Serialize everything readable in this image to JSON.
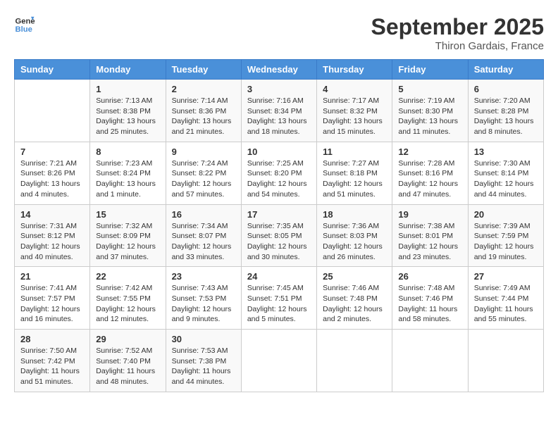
{
  "logo": {
    "line1": "General",
    "line2": "Blue"
  },
  "title": "September 2025",
  "subtitle": "Thiron Gardais, France",
  "days_header": [
    "Sunday",
    "Monday",
    "Tuesday",
    "Wednesday",
    "Thursday",
    "Friday",
    "Saturday"
  ],
  "weeks": [
    [
      {
        "num": "",
        "sunrise": "",
        "sunset": "",
        "daylight": ""
      },
      {
        "num": "1",
        "sunrise": "Sunrise: 7:13 AM",
        "sunset": "Sunset: 8:38 PM",
        "daylight": "Daylight: 13 hours and 25 minutes."
      },
      {
        "num": "2",
        "sunrise": "Sunrise: 7:14 AM",
        "sunset": "Sunset: 8:36 PM",
        "daylight": "Daylight: 13 hours and 21 minutes."
      },
      {
        "num": "3",
        "sunrise": "Sunrise: 7:16 AM",
        "sunset": "Sunset: 8:34 PM",
        "daylight": "Daylight: 13 hours and 18 minutes."
      },
      {
        "num": "4",
        "sunrise": "Sunrise: 7:17 AM",
        "sunset": "Sunset: 8:32 PM",
        "daylight": "Daylight: 13 hours and 15 minutes."
      },
      {
        "num": "5",
        "sunrise": "Sunrise: 7:19 AM",
        "sunset": "Sunset: 8:30 PM",
        "daylight": "Daylight: 13 hours and 11 minutes."
      },
      {
        "num": "6",
        "sunrise": "Sunrise: 7:20 AM",
        "sunset": "Sunset: 8:28 PM",
        "daylight": "Daylight: 13 hours and 8 minutes."
      }
    ],
    [
      {
        "num": "7",
        "sunrise": "Sunrise: 7:21 AM",
        "sunset": "Sunset: 8:26 PM",
        "daylight": "Daylight: 13 hours and 4 minutes."
      },
      {
        "num": "8",
        "sunrise": "Sunrise: 7:23 AM",
        "sunset": "Sunset: 8:24 PM",
        "daylight": "Daylight: 13 hours and 1 minute."
      },
      {
        "num": "9",
        "sunrise": "Sunrise: 7:24 AM",
        "sunset": "Sunset: 8:22 PM",
        "daylight": "Daylight: 12 hours and 57 minutes."
      },
      {
        "num": "10",
        "sunrise": "Sunrise: 7:25 AM",
        "sunset": "Sunset: 8:20 PM",
        "daylight": "Daylight: 12 hours and 54 minutes."
      },
      {
        "num": "11",
        "sunrise": "Sunrise: 7:27 AM",
        "sunset": "Sunset: 8:18 PM",
        "daylight": "Daylight: 12 hours and 51 minutes."
      },
      {
        "num": "12",
        "sunrise": "Sunrise: 7:28 AM",
        "sunset": "Sunset: 8:16 PM",
        "daylight": "Daylight: 12 hours and 47 minutes."
      },
      {
        "num": "13",
        "sunrise": "Sunrise: 7:30 AM",
        "sunset": "Sunset: 8:14 PM",
        "daylight": "Daylight: 12 hours and 44 minutes."
      }
    ],
    [
      {
        "num": "14",
        "sunrise": "Sunrise: 7:31 AM",
        "sunset": "Sunset: 8:12 PM",
        "daylight": "Daylight: 12 hours and 40 minutes."
      },
      {
        "num": "15",
        "sunrise": "Sunrise: 7:32 AM",
        "sunset": "Sunset: 8:09 PM",
        "daylight": "Daylight: 12 hours and 37 minutes."
      },
      {
        "num": "16",
        "sunrise": "Sunrise: 7:34 AM",
        "sunset": "Sunset: 8:07 PM",
        "daylight": "Daylight: 12 hours and 33 minutes."
      },
      {
        "num": "17",
        "sunrise": "Sunrise: 7:35 AM",
        "sunset": "Sunset: 8:05 PM",
        "daylight": "Daylight: 12 hours and 30 minutes."
      },
      {
        "num": "18",
        "sunrise": "Sunrise: 7:36 AM",
        "sunset": "Sunset: 8:03 PM",
        "daylight": "Daylight: 12 hours and 26 minutes."
      },
      {
        "num": "19",
        "sunrise": "Sunrise: 7:38 AM",
        "sunset": "Sunset: 8:01 PM",
        "daylight": "Daylight: 12 hours and 23 minutes."
      },
      {
        "num": "20",
        "sunrise": "Sunrise: 7:39 AM",
        "sunset": "Sunset: 7:59 PM",
        "daylight": "Daylight: 12 hours and 19 minutes."
      }
    ],
    [
      {
        "num": "21",
        "sunrise": "Sunrise: 7:41 AM",
        "sunset": "Sunset: 7:57 PM",
        "daylight": "Daylight: 12 hours and 16 minutes."
      },
      {
        "num": "22",
        "sunrise": "Sunrise: 7:42 AM",
        "sunset": "Sunset: 7:55 PM",
        "daylight": "Daylight: 12 hours and 12 minutes."
      },
      {
        "num": "23",
        "sunrise": "Sunrise: 7:43 AM",
        "sunset": "Sunset: 7:53 PM",
        "daylight": "Daylight: 12 hours and 9 minutes."
      },
      {
        "num": "24",
        "sunrise": "Sunrise: 7:45 AM",
        "sunset": "Sunset: 7:51 PM",
        "daylight": "Daylight: 12 hours and 5 minutes."
      },
      {
        "num": "25",
        "sunrise": "Sunrise: 7:46 AM",
        "sunset": "Sunset: 7:48 PM",
        "daylight": "Daylight: 12 hours and 2 minutes."
      },
      {
        "num": "26",
        "sunrise": "Sunrise: 7:48 AM",
        "sunset": "Sunset: 7:46 PM",
        "daylight": "Daylight: 11 hours and 58 minutes."
      },
      {
        "num": "27",
        "sunrise": "Sunrise: 7:49 AM",
        "sunset": "Sunset: 7:44 PM",
        "daylight": "Daylight: 11 hours and 55 minutes."
      }
    ],
    [
      {
        "num": "28",
        "sunrise": "Sunrise: 7:50 AM",
        "sunset": "Sunset: 7:42 PM",
        "daylight": "Daylight: 11 hours and 51 minutes."
      },
      {
        "num": "29",
        "sunrise": "Sunrise: 7:52 AM",
        "sunset": "Sunset: 7:40 PM",
        "daylight": "Daylight: 11 hours and 48 minutes."
      },
      {
        "num": "30",
        "sunrise": "Sunrise: 7:53 AM",
        "sunset": "Sunset: 7:38 PM",
        "daylight": "Daylight: 11 hours and 44 minutes."
      },
      {
        "num": "",
        "sunrise": "",
        "sunset": "",
        "daylight": ""
      },
      {
        "num": "",
        "sunrise": "",
        "sunset": "",
        "daylight": ""
      },
      {
        "num": "",
        "sunrise": "",
        "sunset": "",
        "daylight": ""
      },
      {
        "num": "",
        "sunrise": "",
        "sunset": "",
        "daylight": ""
      }
    ]
  ]
}
